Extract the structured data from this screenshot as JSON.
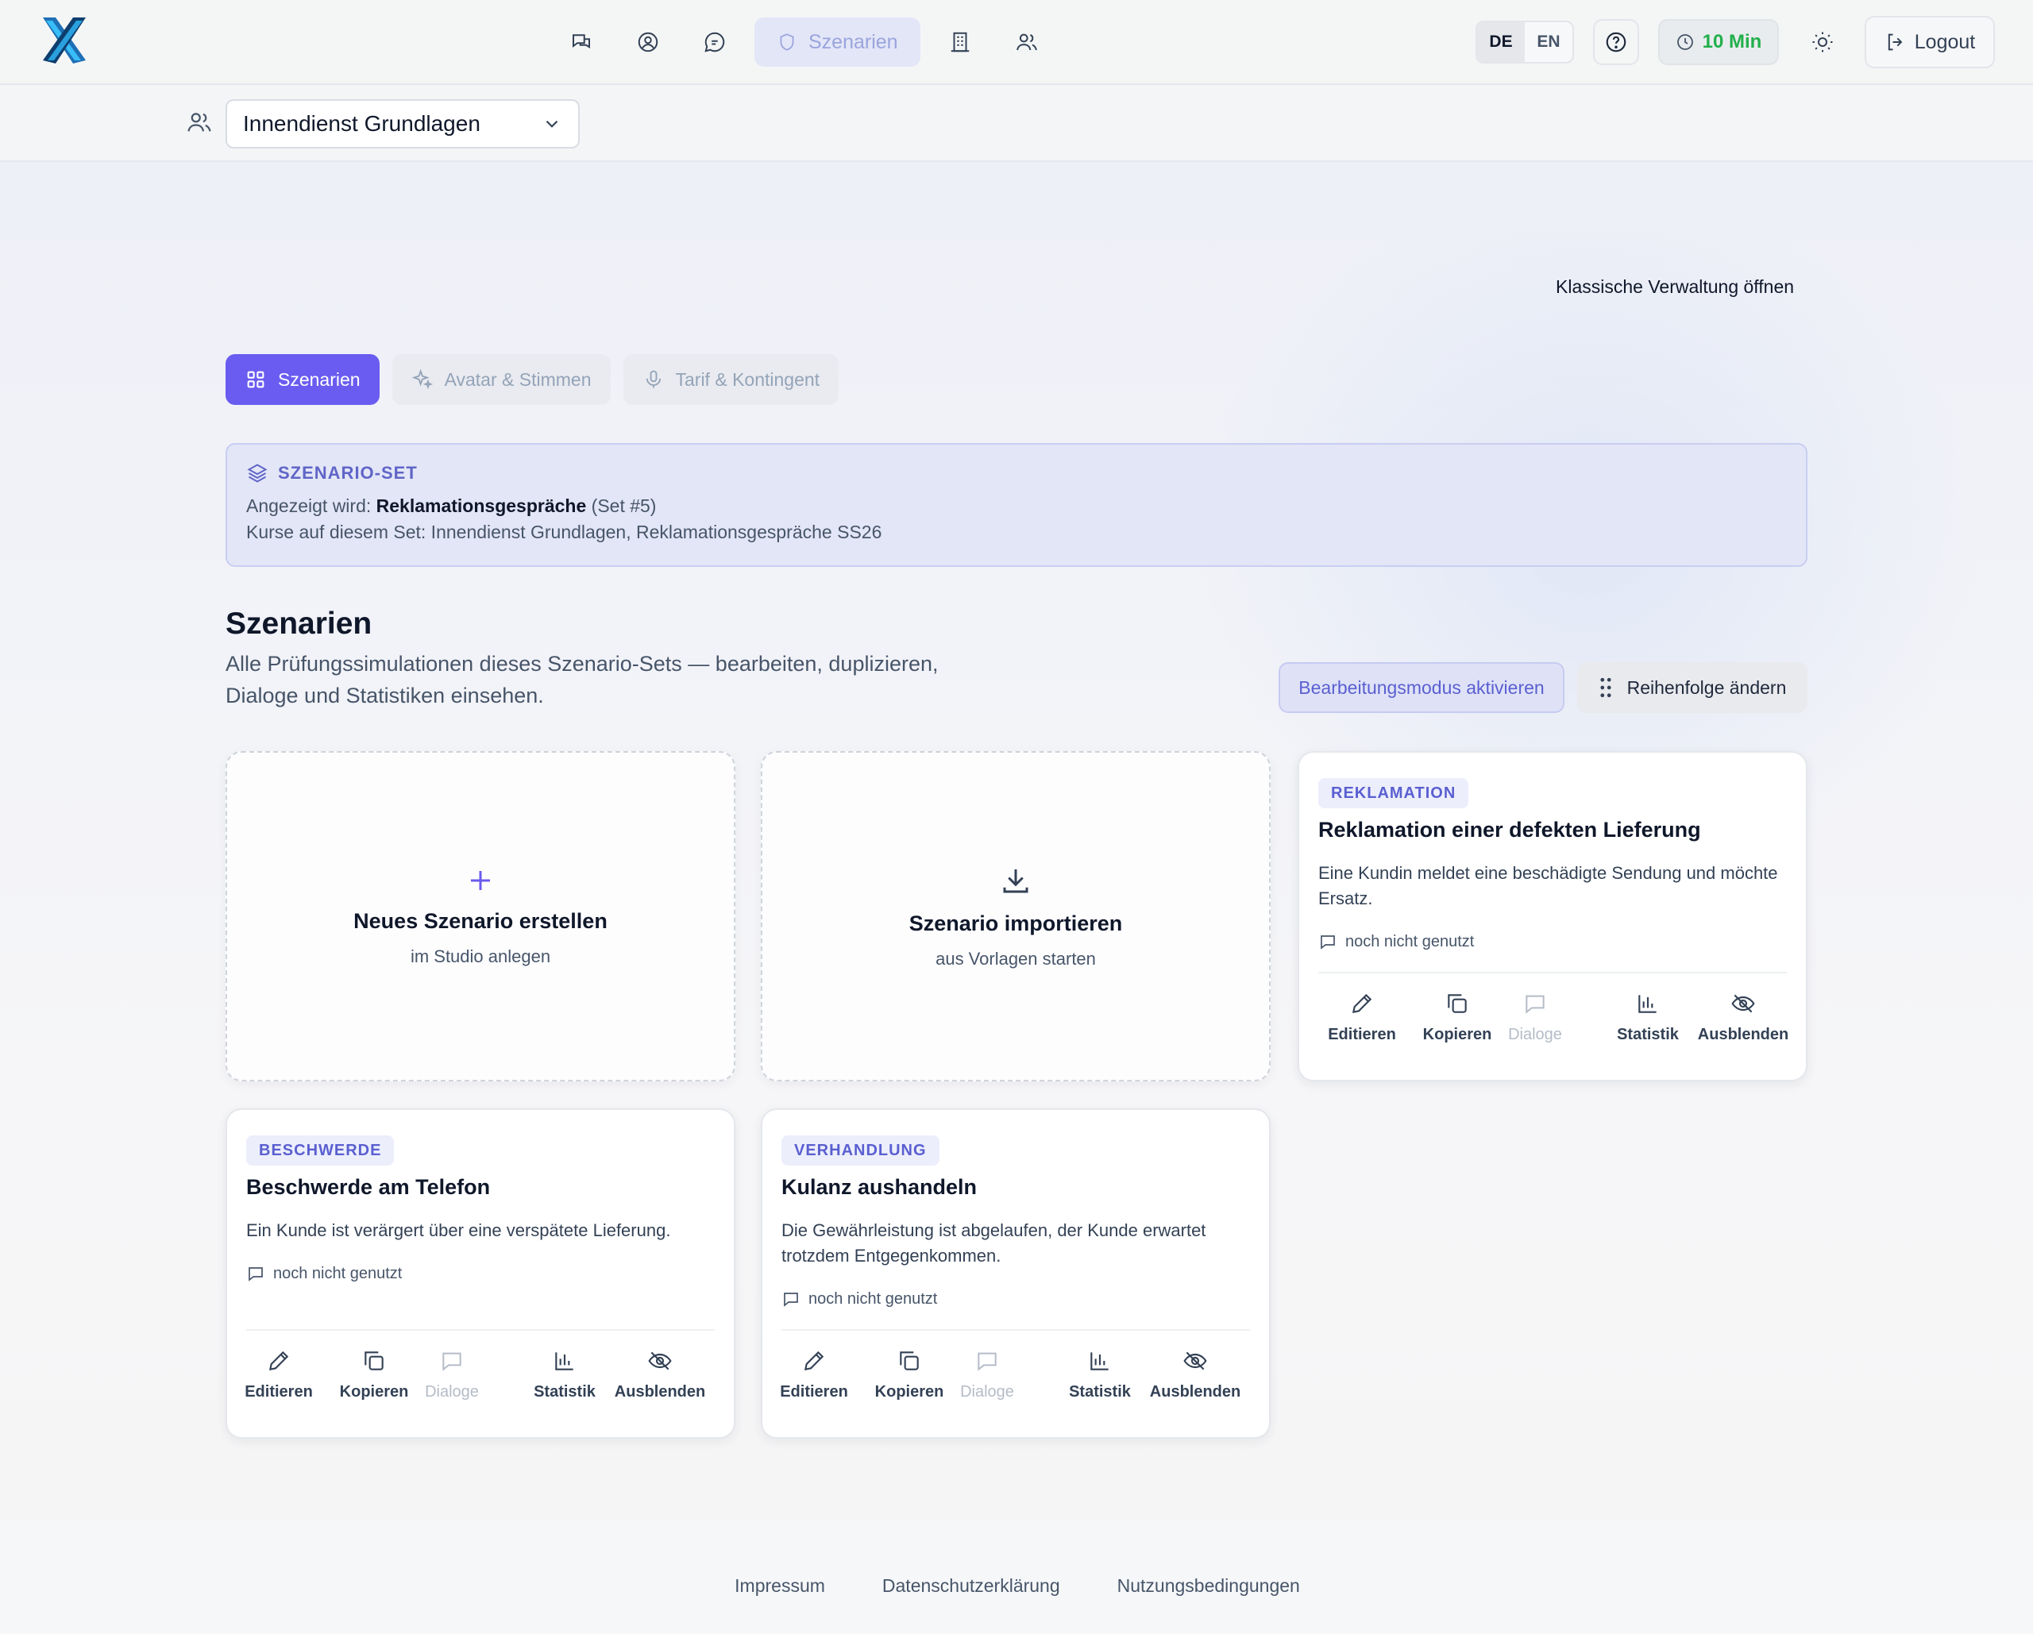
{
  "topbar": {
    "nav_items": [
      "chat-icon",
      "profile-icon",
      "dialog-icon",
      "shield-icon",
      "building-icon",
      "users-icon"
    ],
    "active_nav_label": "Szenarien",
    "lang_de": "DE",
    "lang_en": "EN",
    "timer_label": "10 Min",
    "logout_label": "Logout"
  },
  "course": {
    "selected": "Innendienst Grundlagen"
  },
  "main": {
    "classic_link": "Klassische Verwaltung öffnen",
    "tabs": [
      {
        "label": "Szenarien"
      },
      {
        "label": "Avatar & Stimmen"
      },
      {
        "label": "Tarif & Kontingent"
      }
    ],
    "set": {
      "heading": "SZENARIO-SET",
      "shown_prefix": "Angezeigt wird: ",
      "shown_name": "Reklamationsgespräche",
      "shown_suffix": " (Set #5)",
      "courses_line": "Kurse auf diesem Set: Innendienst Grundlagen, Reklamationsgespräche SS26"
    },
    "section_title": "Szenarien",
    "section_desc": "Alle Prüfungssimulationen dieses Szenario-Sets — bearbeiten, duplizieren, Dialoge und Statistiken einsehen.",
    "edit_mode_label": "Bearbeitungsmodus aktivieren",
    "reorder_label": "Reihenfolge ändern"
  },
  "new_card": {
    "title": "Neues Szenario erstellen",
    "subtitle": "im Studio anlegen"
  },
  "import_card": {
    "title": "Szenario importieren",
    "subtitle": "aus Vorlagen starten"
  },
  "scenarios": [
    {
      "badge": "REKLAMATION",
      "title": "Reklamation einer defekten Lieferung",
      "description": "Eine Kundin meldet eine beschädigte Sendung und möchte Ersatz.",
      "usage": "noch nicht genutzt"
    },
    {
      "badge": "BESCHWERDE",
      "title": "Beschwerde am Telefon",
      "description": "Ein Kunde ist verärgert über eine verspätete Lieferung.",
      "usage": "noch nicht genutzt"
    },
    {
      "badge": "VERHANDLUNG",
      "title": "Kulanz aushandeln",
      "description": "Die Gewährleistung ist abgelaufen, der Kunde erwartet trotzdem Entgegenkommen.",
      "usage": "noch nicht genutzt"
    }
  ],
  "actions": {
    "edit": "Editieren",
    "copy": "Kopieren",
    "dialogs": "Dialoge",
    "stats": "Statistik",
    "hide": "Ausblenden"
  },
  "footer": {
    "imprint": "Impressum",
    "privacy": "Datenschutzerklärung",
    "terms": "Nutzungsbedingungen"
  },
  "colors": {
    "accent": "#6a5cf0",
    "timer_green": "#22b04b",
    "badge_text": "#5a5fd0"
  }
}
